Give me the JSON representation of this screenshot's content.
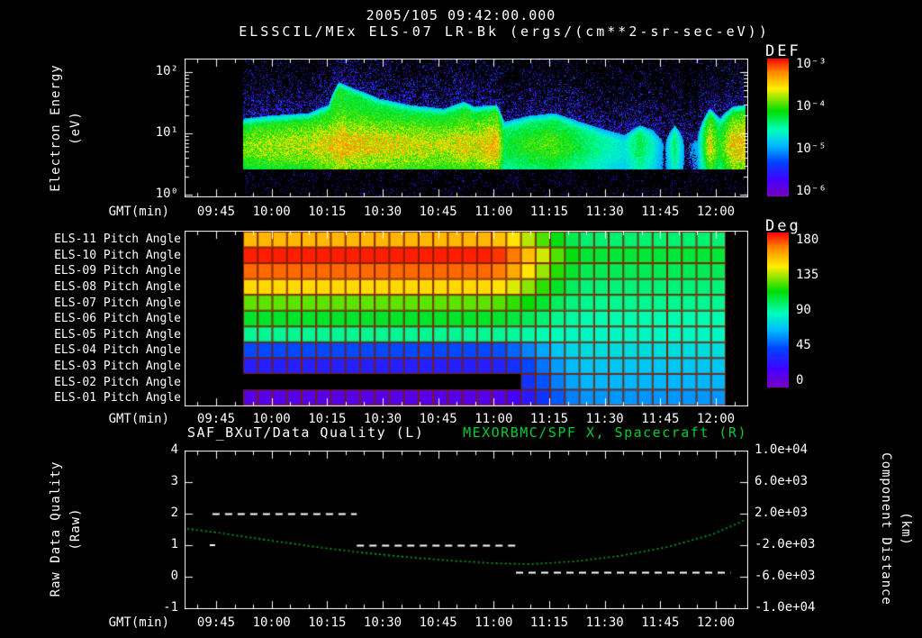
{
  "header": {
    "title": "2005/105 09:42:00.000",
    "subtitle": "ELSSCIL/MEx ELS-07 LR-Bk  (ergs/(cm**2-sr-sec-eV))"
  },
  "axes": {
    "x_label": "GMT(min)",
    "x_ticks": [
      "09:45",
      "10:00",
      "10:15",
      "10:30",
      "10:45",
      "11:00",
      "11:15",
      "11:30",
      "11:45",
      "12:00"
    ]
  },
  "panel1": {
    "ylabel_main": "Electron Energy",
    "ylabel_units": "(eV)",
    "y_ticks": [
      "10²",
      "10¹",
      "10⁰"
    ],
    "colorbar_title": "DEF",
    "colorbar_ticks": [
      "10⁻³",
      "10⁻⁴",
      "10⁻⁵",
      "10⁻⁶"
    ]
  },
  "panel2": {
    "colorbar_title": "Deg",
    "colorbar_ticks": [
      "180",
      "135",
      "90",
      "45",
      "0"
    ]
  },
  "panel3": {
    "title_left": "SAF_BXuT/Data Quality (L)",
    "title_right": "MEXORBMC/SPF X, Spacecraft (R)",
    "ylabel_left_main": "Raw Data Quality",
    "ylabel_left_units": "(Raw)",
    "ylabel_right_main": "Component Distance",
    "ylabel_right_units": "(km)",
    "y_ticks_left": [
      "4",
      "3",
      "2",
      "1",
      "0",
      "-1"
    ],
    "y_ticks_right": [
      "1.0e+04",
      "6.0e+03",
      "2.0e+03",
      "-2.0e+03",
      "-6.0e+03",
      "-1.0e+04"
    ]
  },
  "colors": {
    "background": "#000000",
    "text": "#ffffff",
    "title_right_green": "#00cc33",
    "curve_green": "#00aa22",
    "grid_red": "#7a2000",
    "colormap": [
      [
        0,
        "#ff0000"
      ],
      [
        0.1,
        "#ff8800"
      ],
      [
        0.22,
        "#ffee00"
      ],
      [
        0.38,
        "#00dd00"
      ],
      [
        0.52,
        "#00ffbb"
      ],
      [
        0.63,
        "#00bbff"
      ],
      [
        0.75,
        "#0044ff"
      ],
      [
        0.88,
        "#4400ff"
      ],
      [
        1,
        "#7700bb"
      ]
    ]
  },
  "chart_data": [
    {
      "type": "heatmap",
      "name": "electron-energy-spectrogram",
      "title": "ELSSCIL/MEx ELS-07 LR-Bk",
      "units": "ergs/(cm**2-sr-sec-eV)",
      "xlabel": "GMT(min)",
      "ylabel": "Electron Energy (eV)",
      "y_scale": "log",
      "y_range_eV": [
        1,
        160
      ],
      "colorbar": {
        "label": "DEF",
        "range": [
          "1e-6",
          "1e-3"
        ]
      },
      "x_time_range": [
        "09:36",
        "12:08"
      ],
      "data_time_range": [
        "09:52",
        "12:08"
      ],
      "low_energy_cutoff_eV": 2.6,
      "band_profile_format": "[fraction_of_data_window, band_top_eV, intensity_0_to_1]",
      "band_profile": [
        [
          0,
          18,
          0.7
        ],
        [
          0.05,
          20,
          0.75
        ],
        [
          0.13,
          22,
          0.8
        ],
        [
          0.17,
          30,
          0.9
        ],
        [
          0.19,
          70,
          1
        ],
        [
          0.22,
          55,
          0.95
        ],
        [
          0.27,
          38,
          0.9
        ],
        [
          0.33,
          30,
          0.85
        ],
        [
          0.4,
          26,
          0.8
        ],
        [
          0.44,
          34,
          0.9
        ],
        [
          0.46,
          28,
          0.85
        ],
        [
          0.505,
          30,
          1
        ],
        [
          0.52,
          16,
          0.5
        ],
        [
          0.57,
          20,
          0.6
        ],
        [
          0.62,
          22,
          0.65
        ],
        [
          0.67,
          16,
          0.5
        ],
        [
          0.72,
          12,
          0.35
        ],
        [
          0.76,
          10,
          0.25
        ],
        [
          0.79,
          14,
          0.5
        ],
        [
          0.815,
          12,
          0.3
        ],
        [
          0.84,
          8,
          0.05
        ],
        [
          0.86,
          14,
          0.45
        ],
        [
          0.88,
          8,
          0.05
        ],
        [
          0.905,
          10,
          0.1
        ],
        [
          0.93,
          26,
          0.9
        ],
        [
          0.95,
          18,
          0.55
        ],
        [
          0.975,
          28,
          0.95
        ],
        [
          1,
          30,
          1
        ]
      ]
    },
    {
      "type": "heatmap",
      "name": "pitch-angle-panel",
      "units": "Deg",
      "value_range": [
        0,
        180
      ],
      "columns": 33,
      "data_time_range": [
        "09:52",
        "12:02"
      ],
      "transition_center": "11:12",
      "transition_halfwidth_min": 14,
      "rows": [
        {
          "label": "ELS-11 Pitch Angle",
          "start_deg": 152,
          "end_deg": 96
        },
        {
          "label": "ELS-10 Pitch Angle",
          "start_deg": 176,
          "end_deg": 104
        },
        {
          "label": "ELS-09 Pitch Angle",
          "start_deg": 166,
          "end_deg": 100
        },
        {
          "label": "ELS-08 Pitch Angle",
          "start_deg": 145,
          "end_deg": 95
        },
        {
          "label": "ELS-07 Pitch Angle",
          "start_deg": 122,
          "end_deg": 92
        },
        {
          "label": "ELS-06 Pitch Angle",
          "start_deg": 106,
          "end_deg": 88
        },
        {
          "label": "ELS-05 Pitch Angle",
          "start_deg": 92,
          "end_deg": 84
        },
        {
          "label": "ELS-04 Pitch Angle",
          "start_deg": 46,
          "end_deg": 76
        },
        {
          "label": "ELS-03 Pitch Angle",
          "start_deg": 32,
          "end_deg": 70
        },
        {
          "label": "ELS-02 Pitch Angle",
          "start_deg": 24,
          "end_deg": 66,
          "data_from": "11:07"
        },
        {
          "label": "ELS-01 Pitch Angle",
          "start_deg": 14,
          "end_deg": 60
        }
      ]
    },
    {
      "type": "line",
      "name": "quality-and-spacecraft-x",
      "left_axis": {
        "label": "Raw Data Quality (Raw)",
        "range": [
          -1,
          4
        ]
      },
      "right_axis": {
        "label": "Component Distance (km)",
        "range": [
          -10000,
          10000
        ]
      },
      "series": [
        {
          "name": "SAF_BXuT/Data Quality (L)",
          "axis": "left",
          "color": "#ffffff",
          "style": "dashed",
          "segments": [
            {
              "t_start": "09:44",
              "t_end": "10:23",
              "value": 2
            },
            {
              "t_start": "10:23",
              "t_end": "11:06",
              "value": 1
            },
            {
              "t_start": "11:06",
              "t_end": "12:04",
              "value": 0.15
            }
          ],
          "isolated_points": [
            {
              "t": "09:44",
              "value": 1
            }
          ]
        },
        {
          "name": "MEXORBMC/SPF X, Spacecraft (R)",
          "axis": "right",
          "color": "#00aa22",
          "style": "dotted",
          "t": [
            "09:36",
            "09:47",
            "10:00",
            "10:12",
            "10:24",
            "10:36",
            "10:48",
            "11:00",
            "11:10",
            "11:22",
            "11:34",
            "11:47",
            "11:59",
            "12:08"
          ],
          "km": [
            170,
            -520,
            -1430,
            -2230,
            -2920,
            -3490,
            -3950,
            -4290,
            -4400,
            -4060,
            -3370,
            -2230,
            -630,
            1200
          ]
        }
      ]
    }
  ]
}
